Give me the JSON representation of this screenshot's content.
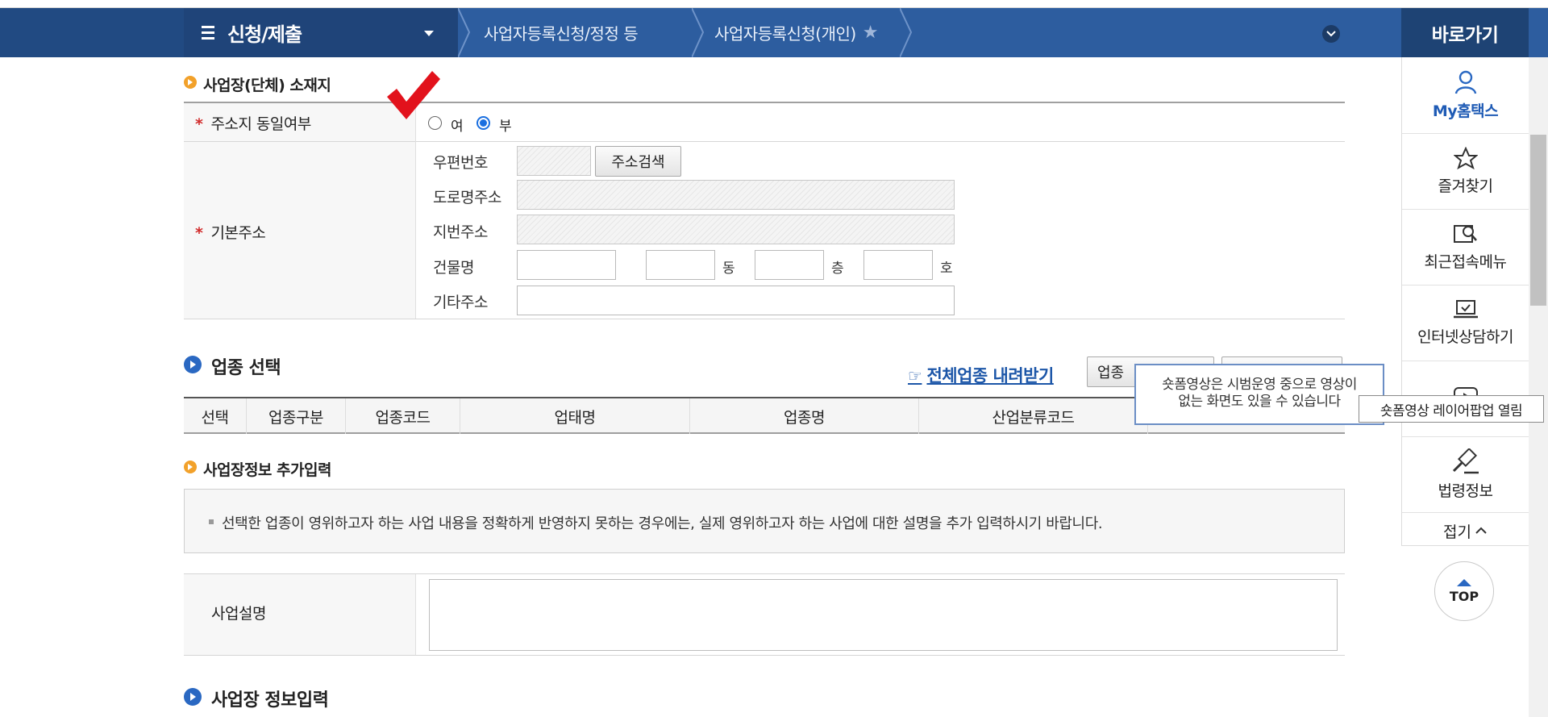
{
  "nav": {
    "menu_title": "신청/제출",
    "crumb1": "사업자등록신청/정정 등",
    "crumb2": "사업자등록신청(개인)",
    "quick_title": "바로가기"
  },
  "quick_panel": {
    "items": [
      {
        "label": "My홈택스",
        "icon": "person-icon"
      },
      {
        "label": "즐겨찾기",
        "icon": "star-icon"
      },
      {
        "label": "최근접속메뉴",
        "icon": "recent-search-icon"
      },
      {
        "label": "인터넷상담하기",
        "icon": "laptop-check-icon"
      },
      {
        "label": "",
        "icon": "video-play-icon"
      },
      {
        "label": "법령정보",
        "icon": "gavel-icon"
      }
    ],
    "fold_label": "접기",
    "top_label": "TOP"
  },
  "location_section": {
    "title": "사업장(단체) 소재지",
    "same_address_label": "주소지 동일여부",
    "radio_yes": "여",
    "radio_no": "부",
    "selected": "부",
    "base_address_label": "기본주소",
    "postal_label": "우편번호",
    "search_button": "주소검색",
    "road_label": "도로명주소",
    "lot_label": "지번주소",
    "building_label": "건물명",
    "unit_dong": "동",
    "unit_floor": "층",
    "unit_ho": "호",
    "etc_label": "기타주소"
  },
  "industry_section": {
    "title": "업종 선택",
    "download_link": "전체업종 내려받기",
    "button_partial": "업종",
    "columns": [
      "선택",
      "업종구분",
      "업종코드",
      "업태명",
      "업종명",
      "산업분류코드"
    ]
  },
  "extra_section": {
    "title": "사업장정보 추가입력",
    "notice": "선택한 업종이 영위하고자 하는 사업 내용을 정확하게 반영하지 못하는 경우에는, 실제 영위하고자 하는 사업에 대한 설명을 추가 입력하시기 바랍니다.",
    "desc_label": "사업설명"
  },
  "next_section": {
    "title": "사업장 정보입력"
  },
  "tooltips": {
    "short_form_line1": "숏폼영상은 시범운영 중으로 영상이",
    "short_form_line2": "없는 화면도 있을 수 있습니다",
    "short_form_hover": "숏폼영상 레이어팝업 열림"
  }
}
